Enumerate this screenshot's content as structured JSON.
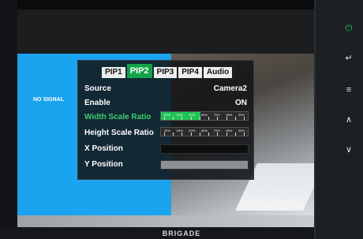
{
  "tabs": [
    "PIP1",
    "PIP2",
    "PIP3",
    "PIP4",
    "Audio"
  ],
  "active_tab": "PIP2",
  "rows": {
    "source": {
      "label": "Source",
      "value": "Camera2"
    },
    "enable": {
      "label": "Enable",
      "value": "ON"
    },
    "width_scale": {
      "label": "Width Scale Ratio",
      "level": 0.45
    },
    "height_scale": {
      "label": "Height Scale Ratio",
      "level": 0.0
    },
    "x_position": {
      "label": "X Position"
    },
    "y_position": {
      "label": "Y Position"
    }
  },
  "no_signal": "NO SIGNAL",
  "slider_tick_labels": [
    "30%",
    "40%",
    "50%",
    "60%",
    "70%",
    "80%",
    "90%"
  ],
  "brand": "BRIGADE",
  "side_buttons": [
    "power-icon",
    "enter-icon",
    "menu-icon",
    "up-arrow-icon",
    "down-arrow-icon"
  ],
  "colors": {
    "accent": "#15a34a",
    "power": "#1fd05a"
  }
}
